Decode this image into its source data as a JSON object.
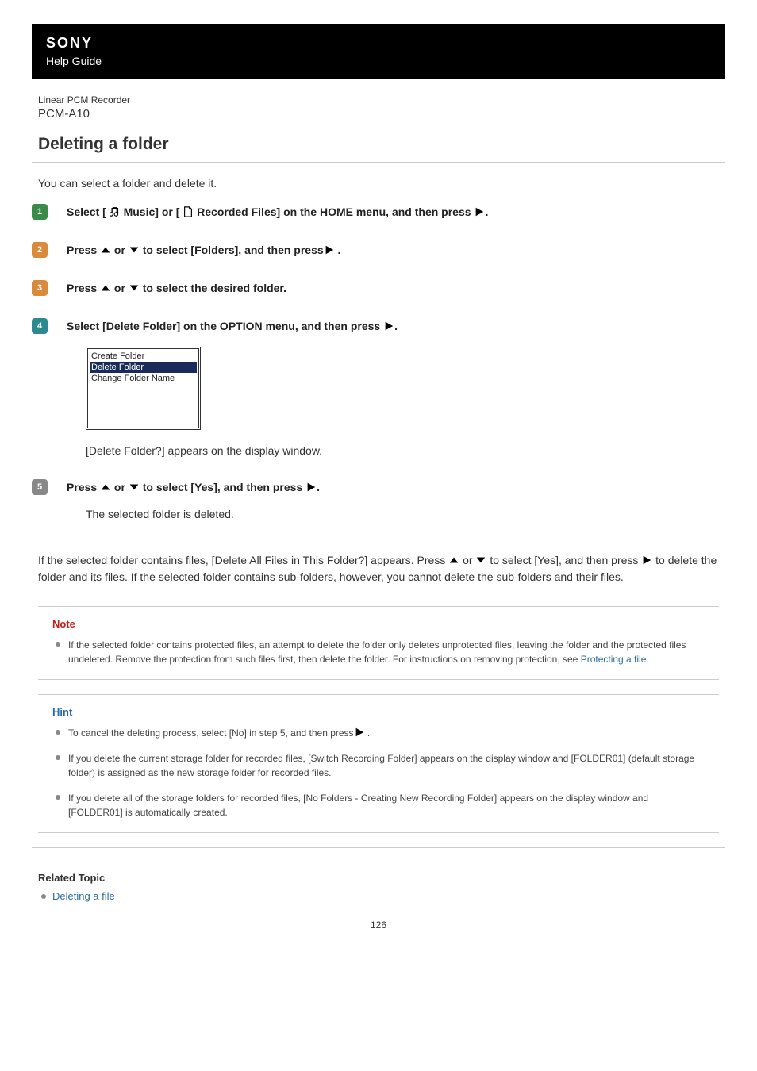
{
  "header": {
    "brand": "SONY",
    "guide": "Help Guide",
    "product_type": "Linear PCM Recorder",
    "model": "PCM-A10"
  },
  "title": "Deleting a folder",
  "intro": "You can select a folder and delete it.",
  "steps": [
    {
      "num": "1",
      "badge": "green",
      "parts": [
        "Select [ ",
        " Music] or [ ",
        " Recorded Files] on the HOME menu, and then press ",
        "."
      ]
    },
    {
      "num": "2",
      "badge": "orange",
      "parts": [
        "Press ",
        " or ",
        " to select [Folders], and then press",
        " ."
      ]
    },
    {
      "num": "3",
      "badge": "orange",
      "parts": [
        "Press ",
        " or ",
        " to select the desired folder."
      ]
    },
    {
      "num": "4",
      "badge": "teal",
      "parts": [
        "Select [Delete Folder] on the OPTION menu, and then press ",
        "."
      ],
      "screenshot": {
        "rows": [
          "Create Folder",
          "Delete Folder",
          "Change Folder Name"
        ],
        "selected": 1
      },
      "after": "[Delete Folder?] appears on the display window."
    },
    {
      "num": "5",
      "badge": "gray",
      "parts": [
        "Press ",
        " or ",
        " to select [Yes], and then press ",
        "."
      ],
      "after": "The selected folder is deleted."
    }
  ],
  "after_steps": {
    "p1a": "If the selected folder contains files, [Delete All Files in This Folder?] appears. Press ",
    "p1b": " or ",
    "p1c": " to select [Yes], and then press ",
    "p1d": " to delete the folder and its files. If the selected folder contains sub-folders, however, you cannot delete the sub-folders and their files."
  },
  "note": {
    "title": "Note",
    "items": [
      {
        "pre": "If the selected folder contains protected files, an attempt to delete the folder only deletes unprotected files, leaving the folder and the protected files undeleted. Remove the protection from such files first, then delete the folder. For instructions on removing protection, see ",
        "link": "Protecting a file",
        "post": "."
      }
    ]
  },
  "hint": {
    "title": "Hint",
    "items": [
      {
        "pre": "To cancel the deleting process, select [No] in step 5, and then press",
        "post": " ."
      },
      {
        "text": "If you delete the current storage folder for recorded files, [Switch Recording Folder] appears on the display window and [FOLDER01] (default storage folder) is assigned as the new storage folder for recorded files."
      },
      {
        "text": "If you delete all of the storage folders for recorded files, [No Folders - Creating New Recording Folder] appears on the display window and [FOLDER01] is automatically created."
      }
    ]
  },
  "related": {
    "title": "Related Topic",
    "items": [
      "Deleting a file"
    ]
  },
  "page_number": "126"
}
